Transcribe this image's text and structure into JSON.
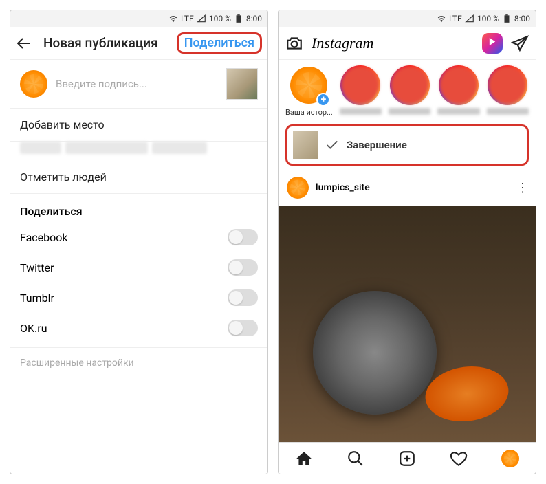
{
  "status": {
    "lte": "LTE",
    "battery": "100 %",
    "time": "8:00"
  },
  "left": {
    "title": "Новая публикация",
    "share": "Поделиться",
    "caption_placeholder": "Введите подпись...",
    "add_location": "Добавить место",
    "tag_people": "Отметить людей",
    "share_section": "Поделиться",
    "networks": [
      "Facebook",
      "Twitter",
      "Tumblr",
      "OK.ru"
    ],
    "advanced": "Расширенные настройки"
  },
  "right": {
    "logo": "Instagram",
    "your_story": "Ваша истор...",
    "completion": "Завершение",
    "username": "lumpics_site"
  }
}
